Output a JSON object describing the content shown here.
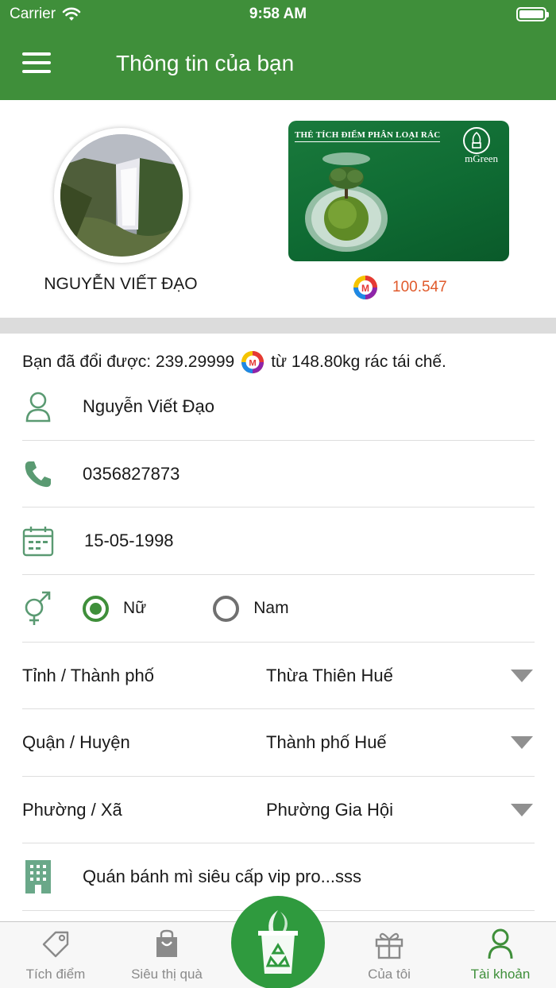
{
  "status_bar": {
    "carrier": "Carrier",
    "time": "9:58 AM"
  },
  "header": {
    "title": "Thông tin của bạn"
  },
  "profile": {
    "name": "NGUYỄN VIẾT ĐẠO",
    "card_title": "THẺ TÍCH ĐIỂM PHÂN LOẠI RÁC",
    "card_brand": "mGreen",
    "points": "100.547"
  },
  "summary": {
    "prefix": "Bạn đã đổi được: 239.29999",
    "suffix": "từ 148.80kg rác tái chế."
  },
  "form": {
    "full_name": "Nguyễn Viết Đạo",
    "phone": "0356827873",
    "birthday": "15-05-1998",
    "gender_options": [
      {
        "label": "Nữ",
        "selected": true
      },
      {
        "label": "Nam",
        "selected": false
      }
    ],
    "province": {
      "label": "Tỉnh / Thành phố",
      "value": "Thừa Thiên Huế"
    },
    "district": {
      "label": "Quận / Huyện",
      "value": "Thành phố Huế"
    },
    "ward": {
      "label": "Phường / Xã",
      "value": "Phường Gia Hội"
    },
    "address": "Quán bánh mì siêu cấp vip pro...sss"
  },
  "tabs": [
    {
      "label": "Tích điểm",
      "icon": "tag-icon",
      "active": false
    },
    {
      "label": "Siêu thị quà",
      "icon": "shopping-bag-icon",
      "active": false
    },
    {
      "label": "Của tôi",
      "icon": "gift-icon",
      "active": false
    },
    {
      "label": "Tài khoản",
      "icon": "user-icon",
      "active": true
    }
  ],
  "colors": {
    "brand_green": "#3f8f3a",
    "points_orange": "#e05a2b",
    "center_button": "#2f9a3e"
  }
}
